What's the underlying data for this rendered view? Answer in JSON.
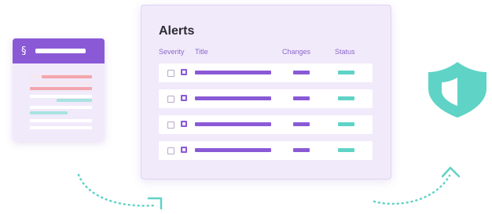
{
  "document_card": {
    "section_symbol": "§"
  },
  "alerts": {
    "title": "Alerts",
    "columns": {
      "severity": "Severity",
      "title": "Title",
      "changes": "Changes",
      "status": "Status"
    },
    "row_count": 4
  },
  "icons": {
    "document": "section-document-icon",
    "shield": "shield-icon",
    "left_arrow": "dotted-arrow-icon",
    "right_arrow": "dotted-arrow-icon"
  },
  "colors": {
    "accent_purple": "#8a5ad6",
    "panel_bg": "#f1eafb",
    "teal": "#5fd3c6",
    "red_highlight": "#f3a6ad"
  }
}
